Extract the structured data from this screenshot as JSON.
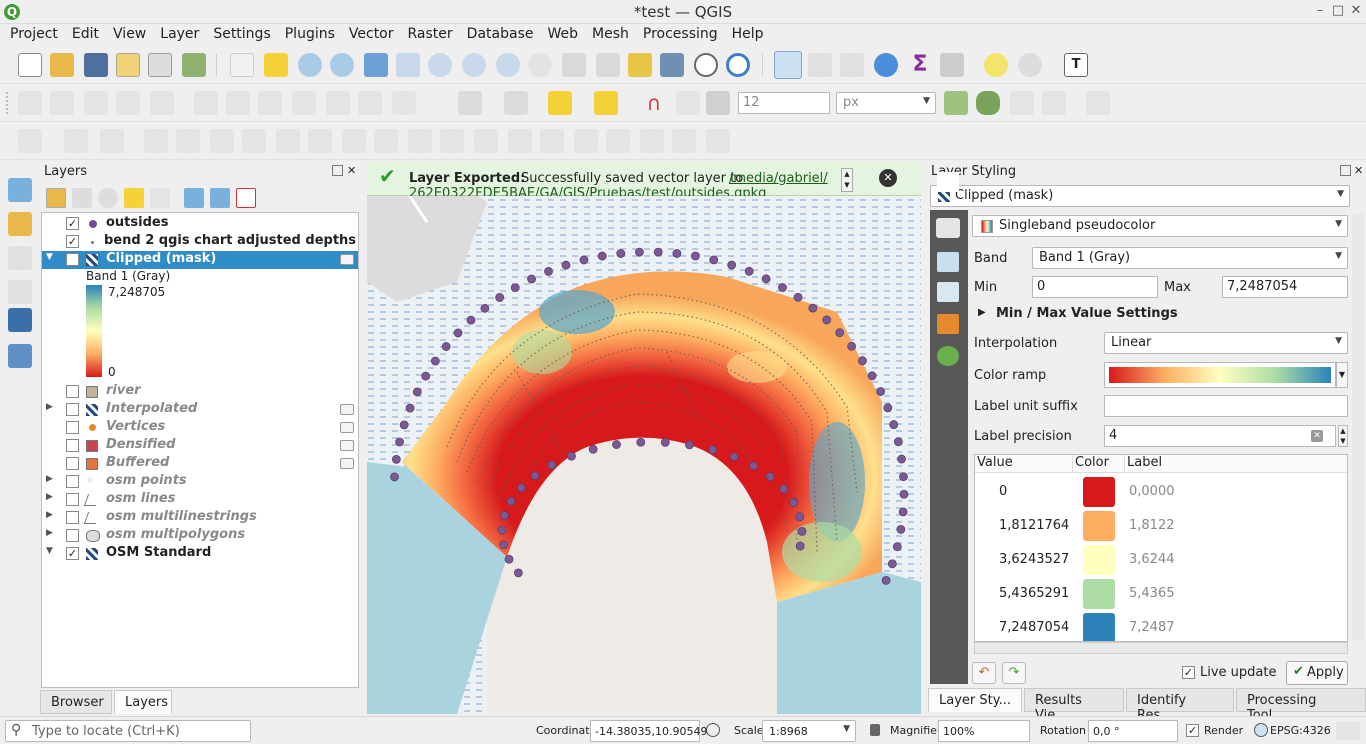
{
  "window": {
    "title": "*test — QGIS",
    "min": "–",
    "max": "□",
    "close": "✕"
  },
  "menu": [
    "Project",
    "Edit",
    "View",
    "Layer",
    "Settings",
    "Plugins",
    "Vector",
    "Raster",
    "Database",
    "Web",
    "Mesh",
    "Processing",
    "Help"
  ],
  "toolbar": {
    "snap_tolerance": "12",
    "snap_unit": "px"
  },
  "layers_panel": {
    "title": "Layers",
    "items": [
      {
        "label": "outsides",
        "checked": true
      },
      {
        "label": "bend 2 qgis chart adjusted depths",
        "checked": true
      },
      {
        "label": "Clipped (mask)",
        "checked": true
      },
      {
        "label": "Band 1 (Gray)"
      },
      {
        "label": "river"
      },
      {
        "label": "Interpolated"
      },
      {
        "label": "Vertices"
      },
      {
        "label": "Densified"
      },
      {
        "label": "Buffered"
      },
      {
        "label": "osm points"
      },
      {
        "label": "osm lines"
      },
      {
        "label": "osm multilinestrings"
      },
      {
        "label": "osm multipolygons"
      },
      {
        "label": "OSM Standard",
        "checked": true
      }
    ],
    "legend_max": "7,248705",
    "legend_min": "0",
    "check": "✓",
    "tabs": [
      "Browser",
      "Layers"
    ]
  },
  "message": {
    "title": "Layer Exported:",
    "text": "Successfully saved vector layer to",
    "link1": "/media/gabriel/",
    "link2": "262E0322FDE5BAE/GA/GIS/Pruebas/test/outsides.gpkg"
  },
  "styling": {
    "title": "Layer Styling",
    "layer": "Clipped (mask)",
    "renderer": "Singleband pseudocolor",
    "band_label": "Band",
    "band": "Band 1 (Gray)",
    "min_label": "Min",
    "min": "0",
    "max_label": "Max",
    "max": "7,2487054",
    "minmax_settings": "Min / Max Value Settings",
    "interpolation_label": "Interpolation",
    "interpolation": "Linear",
    "color_ramp_label": "Color ramp",
    "unit_suffix_label": "Label unit suffix",
    "precision_label": "Label precision",
    "precision": "4",
    "table_headers": [
      "Value",
      "Color",
      "Label"
    ],
    "entries": [
      {
        "value": "0",
        "color": "#d7191c",
        "label": "0,0000"
      },
      {
        "value": "1,8121764",
        "color": "#fdae61",
        "label": "1,8122"
      },
      {
        "value": "3,6243527",
        "color": "#ffffbf",
        "label": "3,6244"
      },
      {
        "value": "5,4365291",
        "color": "#abdda4",
        "label": "5,4365"
      },
      {
        "value": "7,2487054",
        "color": "#2b83ba",
        "label": "7,2487"
      }
    ],
    "live_update": "Live update",
    "apply": "Apply",
    "bottom_tabs": [
      "Layer Sty...",
      "Results Vie...",
      "Identify Res...",
      "Processing Tool..."
    ]
  },
  "status": {
    "locate_placeholder": "Type to locate (Ctrl+K)",
    "coordinate_label": "Coordinate",
    "coordinate": "-14.38035,10.90549",
    "scale_label": "Scale",
    "scale": "1:8968",
    "magnifier_label": "Magnifier",
    "magnifier": "100%",
    "rotation_label": "Rotation",
    "rotation": "0,0 °",
    "render": "Render",
    "crs": "EPSG:4326"
  }
}
